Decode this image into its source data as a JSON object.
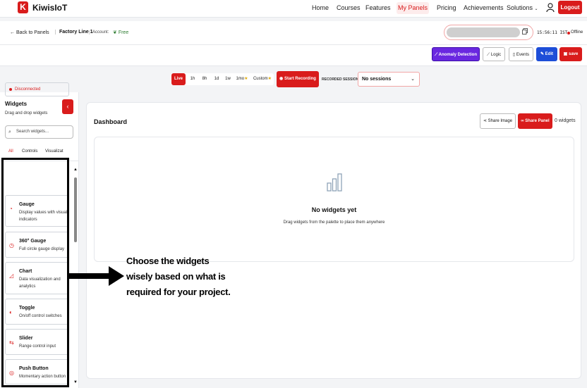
{
  "nav": {
    "brand": "KiwisIoT",
    "links": [
      "Home",
      "Courses",
      "Features",
      "My Panels",
      "Pricing",
      "Achievements",
      "Solutions"
    ],
    "logout": "Logout"
  },
  "panelbar": {
    "back": "Back to Panels",
    "panel_name": "Factory Line 1",
    "account_label": "Account:",
    "plan": "Free",
    "clock": "15:56:11 IST",
    "status": "Offline"
  },
  "toolbar": {
    "anomaly": "Anomaly Detection",
    "logic": "Logic",
    "events": "Events",
    "edit": "Edit",
    "save": "save"
  },
  "range": {
    "options": [
      "Live",
      "1h",
      "8h",
      "1d",
      "1w",
      "1mo",
      "Custom"
    ],
    "start_recording": "Start Recording",
    "recorded_label": "RECORDED SESSIONS",
    "session_value": "No sessions"
  },
  "sidebar": {
    "title": "Widgets",
    "subtitle": "Drag and drop widgets",
    "search_placeholder": "Search widgets...",
    "tabs": [
      "All",
      "Controls",
      "Visualizat"
    ],
    "connection": "Disconnected",
    "widgets": [
      {
        "name": "Gauge",
        "desc": "Display values with visual indicators",
        "icon": "gauge-icon"
      },
      {
        "name": "360° Gauge",
        "desc": "Full circle gauge display",
        "icon": "circle-gauge-icon"
      },
      {
        "name": "Chart",
        "desc": "Data visualization and analytics",
        "icon": "chart-icon"
      },
      {
        "name": "Toggle",
        "desc": "On/off control switches",
        "icon": "toggle-icon"
      },
      {
        "name": "Slider",
        "desc": "Range control input",
        "icon": "slider-icon"
      },
      {
        "name": "Push Button",
        "desc": "Momentary action button",
        "icon": "push-button-icon"
      }
    ]
  },
  "dashboard": {
    "title": "Dashboard",
    "share_image": "Share Image",
    "share_panel": "Share Panel",
    "widget_count": "0 widgets",
    "empty_title": "No widgets yet",
    "empty_sub": "Drag widgets from the palette to place them anywhere"
  },
  "annotation": "Choose the widgets wisely based on what is required for your project.",
  "colors": {
    "brand": "#d91c1c",
    "anomaly": "#6a28e0",
    "edit": "#1d4ed8",
    "plan": "#2f7d32"
  }
}
